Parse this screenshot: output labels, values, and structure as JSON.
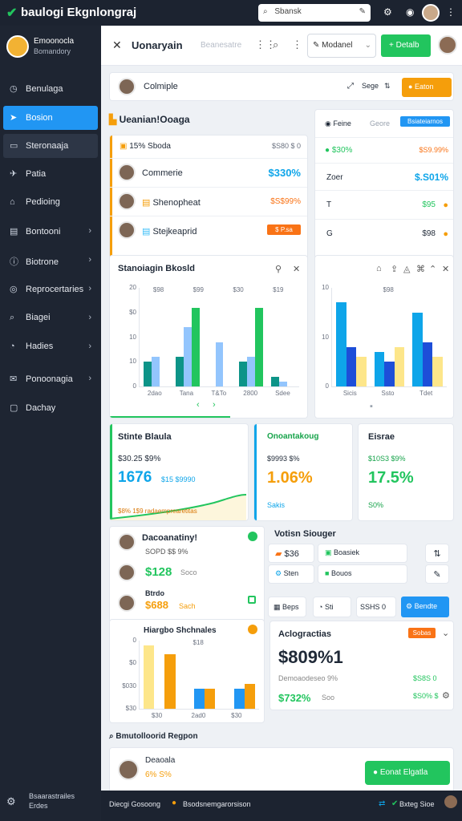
{
  "app": {
    "title": "baulogi Ekgnlongraj",
    "search_placeholder": "Sbansk",
    "search_icon": "search-icon"
  },
  "user": {
    "name": "Emoonocla",
    "role": "Bomandory"
  },
  "sidebar": {
    "items": [
      {
        "label": "Benulaga",
        "icon": "gauge-icon"
      },
      {
        "label": "Bosion",
        "icon": "rocket-icon"
      },
      {
        "label": "Steronaaja",
        "icon": "folder-icon"
      },
      {
        "label": "Patia",
        "icon": "plane-icon"
      },
      {
        "label": "Pedioing",
        "icon": "cart-icon"
      },
      {
        "label": "Bontooni",
        "icon": "document-icon"
      },
      {
        "label": "Biotrone",
        "icon": "info-icon"
      },
      {
        "label": "Reprocertaries",
        "icon": "target-icon"
      },
      {
        "label": "Biagei",
        "icon": "search-icon"
      },
      {
        "label": "Hadies",
        "icon": "clock-icon"
      },
      {
        "label": "Ponoonagia",
        "icon": "mail-icon"
      },
      {
        "label": "Dachay",
        "icon": "box-icon"
      }
    ],
    "footer": {
      "line1": "Bsaarastrailes",
      "line2": "Erdes"
    }
  },
  "header": {
    "title": "Uonaryain",
    "subtitle": "Beanesatre",
    "dropdown": "Modanel",
    "button": "Detalb"
  },
  "topcard": {
    "name": "Colmiple",
    "action": "Sege",
    "button": "Eaton"
  },
  "people": {
    "title": "Ueanian!Ooaga",
    "summary": {
      "label": "15% Sboda",
      "value": "$S80 $ 0"
    },
    "rows": [
      {
        "name": "Commerie",
        "value": "$330%"
      },
      {
        "name": "Shenopheat",
        "value": "$S$99%"
      },
      {
        "name": "Stejkeaprid",
        "value": "$ P.sa"
      }
    ]
  },
  "tabs": {
    "tab1": "Feine",
    "tab2": "Geore",
    "button": "Bsiateiarnos"
  },
  "stats": {
    "summary_left": "$30%",
    "summary_right": "$S9.99%",
    "rows": [
      {
        "label": "Zoer",
        "value": "$.S01%"
      },
      {
        "label": "T",
        "value": "$95"
      },
      {
        "label": "G",
        "value": "$98"
      }
    ]
  },
  "chart1": {
    "title": "Stanoiagin Bkosld"
  },
  "chart_data": [
    {
      "type": "bar",
      "title": "Stanoiagin Bkosld",
      "ylim": [
        0,
        20
      ],
      "yticks": [
        "0",
        "10",
        "10",
        "$0",
        "20"
      ],
      "categories": [
        "2dao",
        "Tana",
        "T&To",
        "2800",
        "Sdee"
      ],
      "series": [
        {
          "values": [
            5,
            6,
            0,
            5,
            2
          ]
        },
        {
          "values": [
            6,
            12,
            9,
            6,
            1
          ]
        },
        {
          "values": [
            0,
            16,
            0,
            16,
            0
          ]
        }
      ],
      "labels": [
        "$98",
        "$99",
        "$30",
        "$19"
      ]
    },
    {
      "type": "bar",
      "ylim": [
        0,
        10
      ],
      "yticks": [
        "0",
        "10",
        "10"
      ],
      "categories": [
        "Sicis",
        "Ssto",
        "Tdet"
      ],
      "series": [
        {
          "values": [
            8.5,
            3.5,
            7.5
          ]
        },
        {
          "values": [
            4,
            2.5,
            4.5
          ]
        },
        {
          "values": [
            3,
            4,
            3
          ]
        }
      ],
      "labels": [
        "$98"
      ]
    },
    {
      "type": "bar",
      "title": "Hiargbo Shchnales",
      "ylim": [
        0,
        30
      ],
      "yticks": [
        "$30",
        "$030",
        "$0",
        "0"
      ],
      "categories": [
        "$30",
        "2ad0",
        "$30"
      ],
      "series": [
        {
          "values": [
            28,
            0,
            0
          ]
        },
        {
          "values": [
            0,
            9,
            9
          ]
        },
        {
          "values": [
            24,
            9,
            11
          ]
        }
      ],
      "labels": [
        "$18"
      ]
    }
  ],
  "kpi": {
    "card1": {
      "title": "Stinte Blaula",
      "sub": "$30.25 $9%",
      "value": "1676",
      "delta": "$15 $9990",
      "foot": "$8% 1$9 radaemprearetitas"
    },
    "card2": {
      "title": "Onoantakoug",
      "sub": "$9993 $%",
      "value": "1.06%",
      "foot": "Sakis"
    },
    "card3": {
      "title": "Eisrae",
      "sub": "$10S3 $9%",
      "value": "17.5%",
      "foot": "S0%"
    }
  },
  "list2": {
    "title": "Dacoanatiny!",
    "rows": [
      {
        "sub": "SOPD $$ 9%",
        "value": ""
      },
      {
        "value": "$128",
        "sub": "Soco"
      },
      {
        "title": "Btrdo",
        "value": "$688",
        "sub": "Sach"
      }
    ]
  },
  "panel": {
    "title": "Votisn Siouger",
    "item1": "$36",
    "item2": "Boasiek",
    "item3": "Sten",
    "item4": "Bouos",
    "btn1": "Beps",
    "btn2": "Sti",
    "btn3": "SSHS 0",
    "btn4": "Bendte"
  },
  "analytics": {
    "title": "Aclogractias",
    "badge": "Sobas",
    "value": "$809%1",
    "sub1": "Demoaodeseo 9%",
    "sub1r": "$S8S 0",
    "value2": "$732%",
    "value2_sub": "Soo",
    "value2r": "$S0% $"
  },
  "report": {
    "title": "Bmutolloorid Regpon",
    "name": "Deaoala",
    "sub": "6% S%",
    "button": "Eonat Elgatla"
  },
  "bottombar": {
    "left": "Diecgi Gosoong",
    "mid": "Bsodsnemgarorsison",
    "right": "Bxteg Sioe"
  },
  "colors": {
    "accent": "#2196f3",
    "green": "#22c55e",
    "orange": "#f59e0b",
    "dark": "#1c2330"
  }
}
